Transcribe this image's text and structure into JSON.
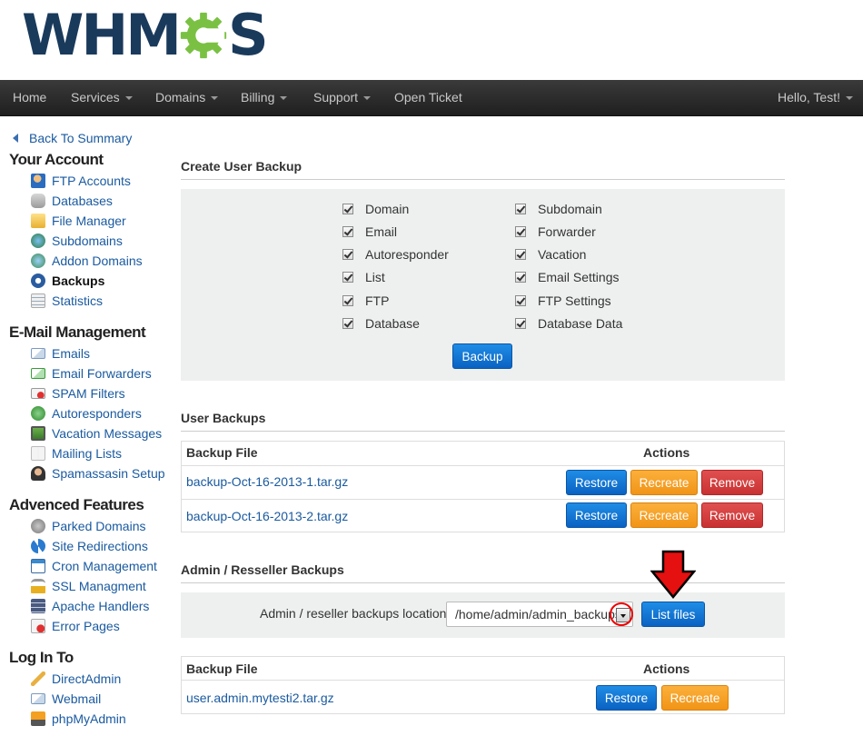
{
  "logo": {
    "text_left": "WHM",
    "text_right": "S"
  },
  "nav": {
    "items": [
      {
        "label": "Home",
        "dropdown": false
      },
      {
        "label": "Services",
        "dropdown": true
      },
      {
        "label": "Domains",
        "dropdown": true
      },
      {
        "label": "Billing",
        "dropdown": true
      },
      {
        "label": "Support",
        "dropdown": true
      },
      {
        "label": "Open Ticket",
        "dropdown": false
      }
    ],
    "user": "Hello, Test!"
  },
  "sidebar": {
    "back": "Back To Summary",
    "sections": [
      {
        "title": "Your Account",
        "items": [
          "FTP Accounts",
          "Databases",
          "File Manager",
          "Subdomains",
          "Addon Domains",
          "Backups",
          "Statistics"
        ]
      },
      {
        "title": "E-Mail Management",
        "items": [
          "Emails",
          "Email Forwarders",
          "SPAM Filters",
          "Autoresponders",
          "Vacation Messages",
          "Mailing Lists",
          "Spamassasin Setup"
        ]
      },
      {
        "title": "Advenced Features",
        "items": [
          "Parked Domains",
          "Site Redirections",
          "Cron Management",
          "SSL Managment",
          "Apache Handlers",
          "Error Pages"
        ]
      },
      {
        "title": "Log In To",
        "items": [
          "DirectAdmin",
          "Webmail",
          "phpMyAdmin"
        ]
      }
    ],
    "active_item": "Backups"
  },
  "create_backup": {
    "title": "Create User Backup",
    "left_options": [
      "Domain",
      "Email",
      "Autoresponder",
      "List",
      "FTP",
      "Database"
    ],
    "right_options": [
      "Subdomain",
      "Forwarder",
      "Vacation",
      "Email Settings",
      "FTP Settings",
      "Database Data"
    ],
    "all_checked": true,
    "button": "Backup"
  },
  "user_backups": {
    "title": "User Backups",
    "col_file": "Backup File",
    "col_actions": "Actions",
    "rows": [
      "backup-Oct-16-2013-1.tar.gz",
      "backup-Oct-16-2013-2.tar.gz"
    ],
    "restore": "Restore",
    "recreate": "Recreate",
    "remove": "Remove"
  },
  "admin_backups": {
    "title": "Admin / Resseller Backups",
    "location_label": "Admin / reseller backups location:",
    "location_value": "/home/admin/admin_backups",
    "list_button": "List files",
    "col_file": "Backup File",
    "col_actions": "Actions",
    "rows": [
      "user.admin.mytesti2.tar.gz"
    ],
    "restore": "Restore",
    "recreate": "Recreate"
  },
  "colors": {
    "accent_blue": "#0a62c2",
    "orange": "#f19417",
    "red": "#c93131",
    "logo_green": "#7ac143",
    "logo_navy": "#1a3a5c"
  }
}
